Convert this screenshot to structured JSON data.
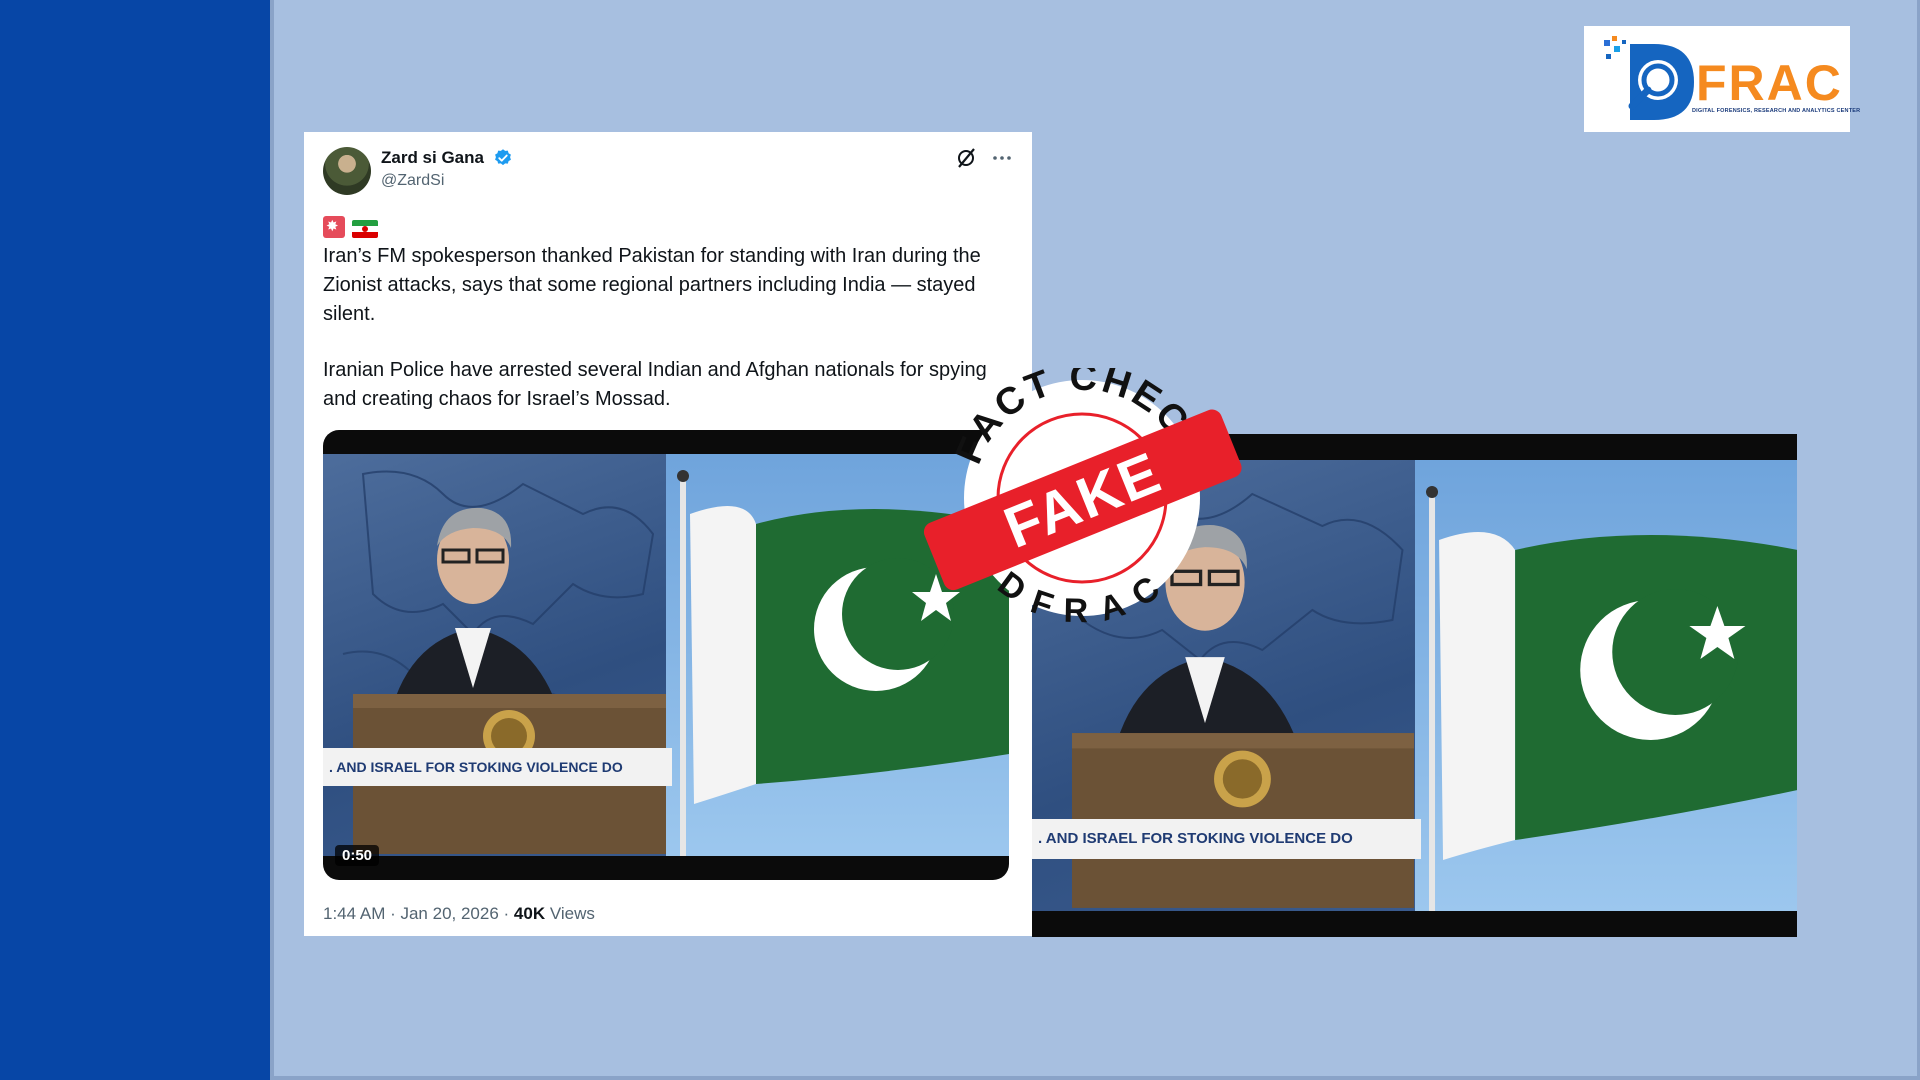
{
  "logo": {
    "word": "FRAC",
    "subtitle": "DIGITAL FORENSICS, RESEARCH AND ANALYTICS CENTER",
    "brand_color": "#f58a1f",
    "brand_blue": "#1565c0"
  },
  "tweet": {
    "author_name": "Zard si Gana",
    "handle": "@ZardSi",
    "verified": true,
    "emoji_flags": [
      "flag-icon",
      "iran-flag-icon"
    ],
    "paragraph_1": "Iran’s FM spokesperson thanked Pakistan for standing with Iran during the Zionist attacks, says that some regional partners including India — stayed silent.",
    "paragraph_2": "Iranian Police have arrested several Indian and Afghan nationals for spying and creating chaos for Israel’s Mossad.",
    "video_duration": "0:50",
    "video_ticker": ". AND ISRAEL FOR STOKING VIOLENCE DO",
    "timestamp": "1:44 AM · Jan 20, 2026 · ",
    "views_count": "40K",
    "views_label": " Views"
  },
  "stamp": {
    "arc_top": "FACT CHECK",
    "arc_bottom": "DFRAC",
    "banner": "FAKE",
    "color": "#e8202a"
  },
  "colors": {
    "background": "#a7bfe0",
    "side_band": "#0746a6",
    "verified_blue": "#1d9bf0"
  }
}
